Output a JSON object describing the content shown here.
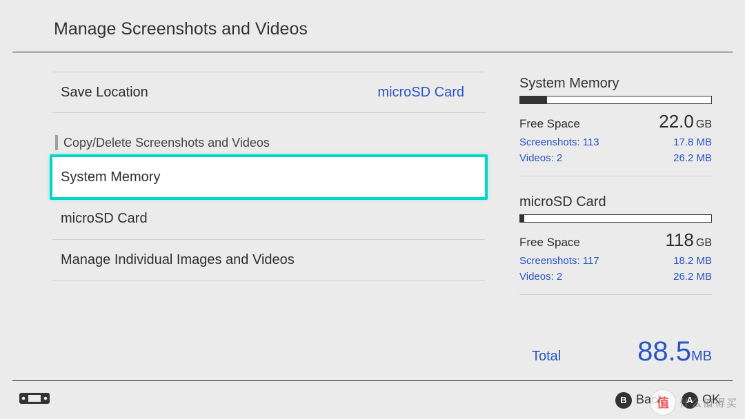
{
  "header": {
    "title": "Manage Screenshots and Videos"
  },
  "left": {
    "save_location_label": "Save Location",
    "save_location_value": "microSD Card",
    "section_label": "Copy/Delete Screenshots and Videos",
    "items": [
      {
        "label": "System Memory",
        "selected": true
      },
      {
        "label": "microSD Card",
        "selected": false
      },
      {
        "label": "Manage Individual Images and Videos",
        "selected": false
      }
    ]
  },
  "right": {
    "storages": [
      {
        "name": "System Memory",
        "bar_fill_pct": 14,
        "free_label": "Free Space",
        "free_value": "22.0",
        "free_unit": "GB",
        "screenshots_label": "Screenshots: 113",
        "screenshots_size": "17.8 MB",
        "videos_label": "Videos: 2",
        "videos_size": "26.2 MB"
      },
      {
        "name": "microSD Card",
        "bar_fill_pct": 2,
        "free_label": "Free Space",
        "free_value": "118",
        "free_unit": "GB",
        "screenshots_label": "Screenshots: 117",
        "screenshots_size": "18.2 MB",
        "videos_label": "Videos: 2",
        "videos_size": "26.2 MB"
      }
    ],
    "total_label": "Total",
    "total_value": "88.5",
    "total_unit": "MB"
  },
  "footer": {
    "back_label": "Back",
    "ok_label": "OK"
  },
  "watermark": {
    "badge": "值",
    "text": "什么值得买"
  }
}
